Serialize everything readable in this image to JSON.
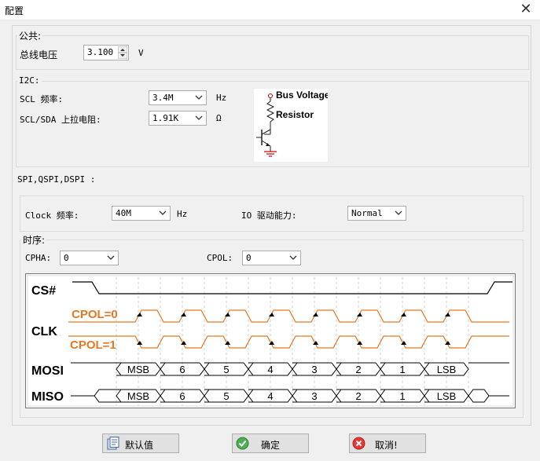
{
  "window": {
    "title": "配置"
  },
  "common": {
    "label": "公共:",
    "bus_voltage_label": "总线电压",
    "bus_voltage_value": "3.100",
    "bus_voltage_unit": "V"
  },
  "i2c": {
    "label": "I2C:",
    "scl_freq_label": "SCL 频率:",
    "scl_freq_value": "3.4M",
    "scl_freq_unit": "Hz",
    "pullup_label": "SCL/SDA 上拉电阻:",
    "pullup_value": "1.91K",
    "pullup_unit": "Ω",
    "diagram": {
      "line1": "Bus Voltage",
      "line2": "Resistor"
    }
  },
  "spi": {
    "label": "SPI,QSPI,DSPI :",
    "clock_label": "Clock 频率:",
    "clock_value": "40M",
    "clock_unit": "Hz",
    "io_label": "IO 驱动能力:",
    "io_value": "Normal",
    "timing_label": "时序:",
    "cpha_label": "CPHA:",
    "cpha_value": "0",
    "cpol_label": "CPOL:",
    "cpol_value": "0",
    "waveform": {
      "cs_label": "CS#",
      "clk_label": "CLK",
      "mosi_label": "MOSI",
      "miso_label": "MISO",
      "cpol0_label": "CPOL=0",
      "cpol1_label": "CPOL=1",
      "bits": [
        "MSB",
        "6",
        "5",
        "4",
        "3",
        "2",
        "1",
        "LSB"
      ],
      "accent_color": "#e87722"
    }
  },
  "buttons": {
    "default_label": "默认值",
    "ok_label": "确定",
    "cancel_label": "取消!"
  }
}
